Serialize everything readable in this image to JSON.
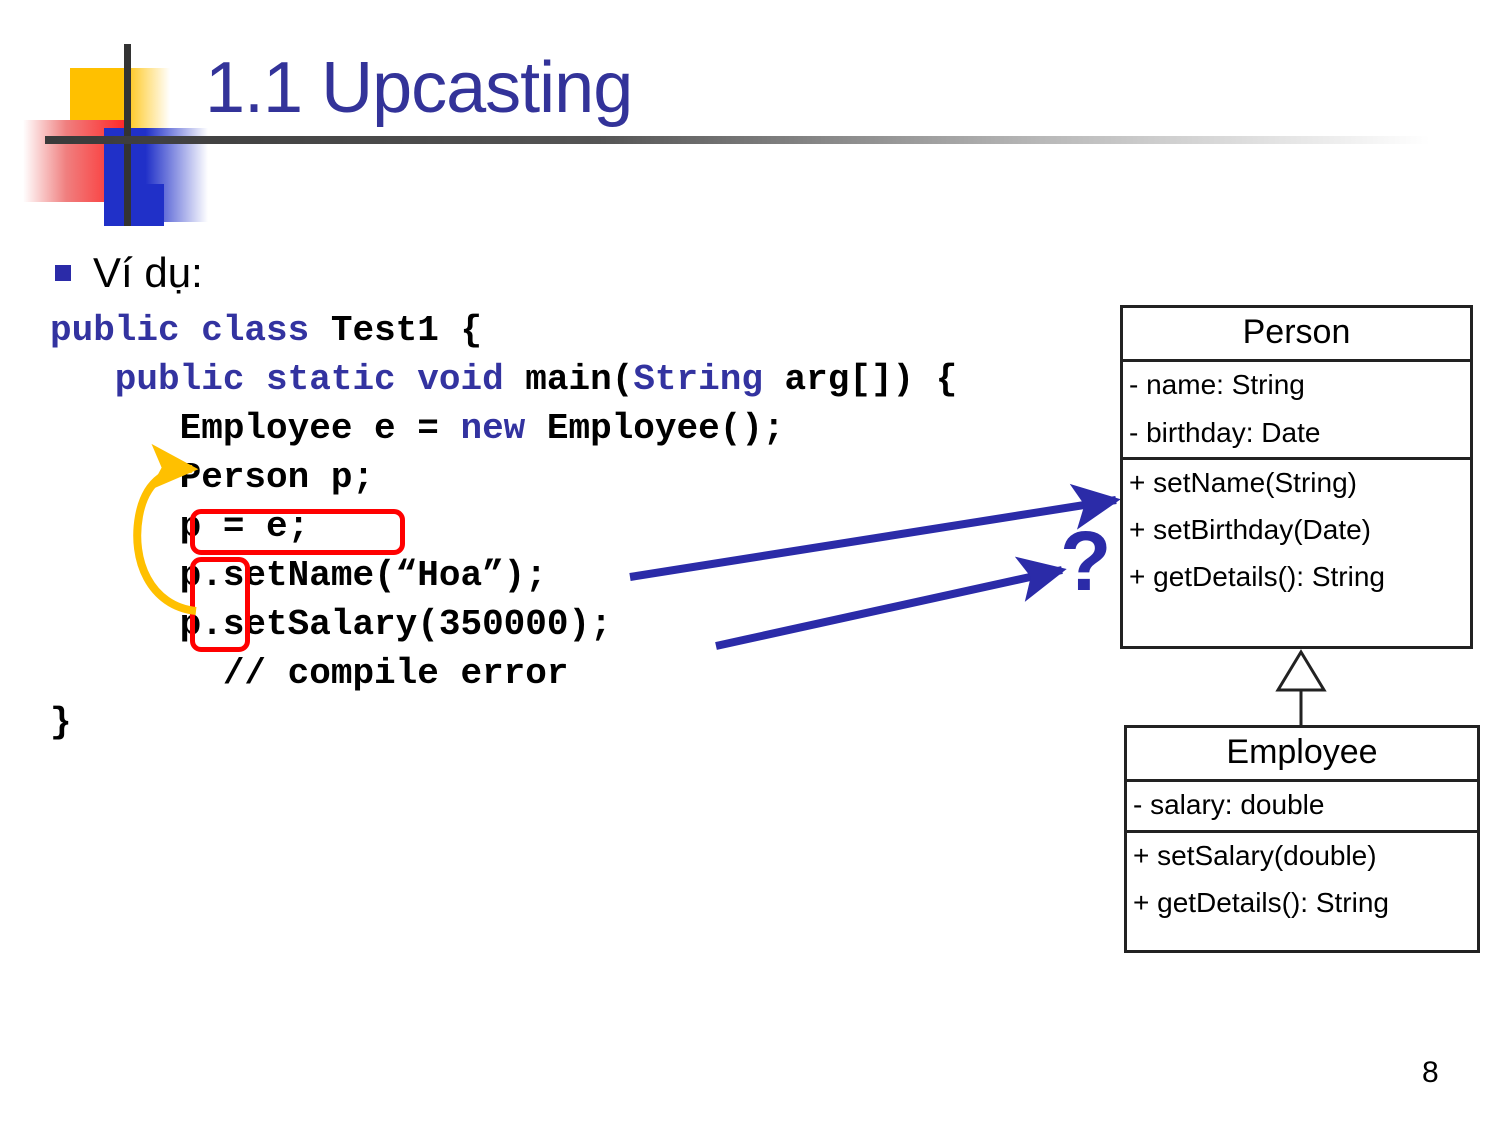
{
  "slide": {
    "title": "1.1 Upcasting",
    "page_number": "8",
    "title_color": "#333399",
    "accent_blue": "#2B2BA8",
    "highlight_red": "#FF0000",
    "arrow_yellow": "#FFC000"
  },
  "bullet": {
    "icon": "square-bullet-icon",
    "label": "Ví dụ:"
  },
  "code": {
    "language": "java",
    "lines": [
      [
        {
          "t": "public class ",
          "c": "keyword"
        },
        {
          "t": "Test1 {",
          "c": "plain"
        }
      ],
      [
        {
          "t": "   public static void ",
          "c": "keyword"
        },
        {
          "t": "main(",
          "c": "plain"
        },
        {
          "t": "String",
          "c": "keyword"
        },
        {
          "t": " arg[]) {",
          "c": "plain"
        }
      ],
      [
        {
          "t": "      Employee e = ",
          "c": "plain"
        },
        {
          "t": "new ",
          "c": "keyword"
        },
        {
          "t": "Employee();",
          "c": "plain"
        }
      ],
      [
        {
          "t": "      Person p;",
          "c": "plain"
        }
      ],
      [
        {
          "t": "      p = e;",
          "c": "plain"
        }
      ],
      [
        {
          "t": "      p.setName(“Hoa”);",
          "c": "plain"
        }
      ],
      [
        {
          "t": "      p.setSalary(350000);",
          "c": "plain"
        }
      ],
      [
        {
          "t": "        // compile error",
          "c": "plain"
        }
      ],
      [
        {
          "t": "}",
          "c": "plain"
        }
      ]
    ]
  },
  "annotations": {
    "question_mark": "?",
    "yellow_arrow_name": "upcast-reference-arrow",
    "blue_arrow_1_name": "setname-resolves-arrow",
    "blue_arrow_2_name": "setsalary-unresolved-arrow",
    "red_box_1_name": "upcast-assignment-highlight",
    "red_box_2_name": "reference-prefix-highlight"
  },
  "uml": {
    "person": {
      "name": "Person",
      "attributes": [
        "- name: String",
        "- birthday: Date"
      ],
      "methods": [
        "+ setName(String)",
        "+ setBirthday(Date)",
        "+ getDetails(): String"
      ]
    },
    "employee": {
      "name": "Employee",
      "attributes": [
        "- salary: double"
      ],
      "methods": [
        "+ setSalary(double)",
        "+ getDetails(): String"
      ]
    },
    "relationship": "inheritance-generalization-arrow"
  }
}
